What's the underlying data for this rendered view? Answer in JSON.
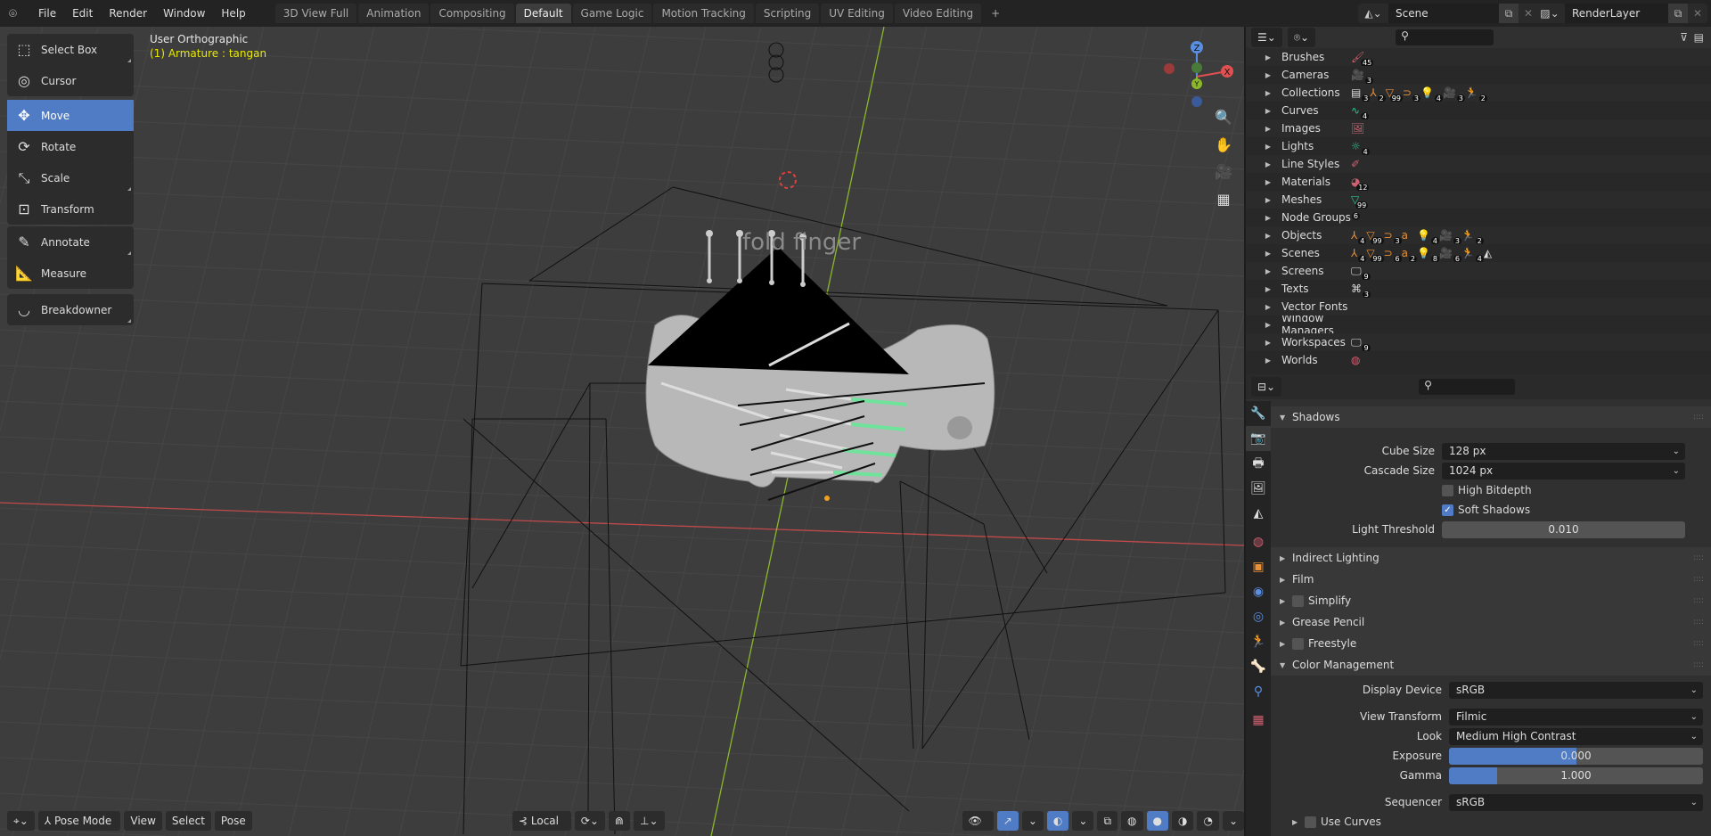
{
  "topbar": {
    "menus": [
      "File",
      "Edit",
      "Render",
      "Window",
      "Help"
    ],
    "workspaces": [
      "3D View Full",
      "Animation",
      "Compositing",
      "Default",
      "Game Logic",
      "Motion Tracking",
      "Scripting",
      "UV Editing",
      "Video Editing"
    ],
    "active_workspace": "Default",
    "add_tab": "+",
    "scene": "Scene",
    "view_layer": "RenderLayer"
  },
  "toolbar": {
    "tools": [
      {
        "label": "Select Box",
        "icon": "select-box-icon",
        "glyph": "⬚"
      },
      {
        "label": "Cursor",
        "icon": "cursor-icon",
        "glyph": "◎"
      },
      {
        "label": "Move",
        "icon": "move-icon",
        "glyph": "✥",
        "active": true
      },
      {
        "label": "Rotate",
        "icon": "rotate-icon",
        "glyph": "⟳"
      },
      {
        "label": "Scale",
        "icon": "scale-icon",
        "glyph": "⤡"
      },
      {
        "label": "Transform",
        "icon": "transform-icon",
        "glyph": "⊡"
      },
      {
        "label": "Annotate",
        "icon": "annotate-icon",
        "glyph": "✎"
      },
      {
        "label": "Measure",
        "icon": "measure-icon",
        "glyph": "📐"
      },
      {
        "label": "Breakdowner",
        "icon": "breakdowner-icon",
        "glyph": "◡"
      }
    ]
  },
  "viewport": {
    "view_name": "User Orthographic",
    "active_object": "(1) Armature : tangan",
    "overlay_text": "fold finger",
    "gizmo": {
      "z": "Z",
      "x": "X",
      "y": "Y"
    },
    "header": {
      "mode": "Pose Mode",
      "menus": [
        "View",
        "Select",
        "Pose"
      ],
      "orientation": "Local"
    }
  },
  "outliner": {
    "rows": [
      {
        "label": "Brushes",
        "icons": [
          {
            "g": "🖌",
            "c": "#d06070",
            "n": "45"
          }
        ]
      },
      {
        "label": "Cameras",
        "icons": [
          {
            "g": "🎥",
            "c": "#30c090",
            "n": "3"
          }
        ]
      },
      {
        "label": "Collections",
        "icons": [
          {
            "g": "▤",
            "c": "#ddd",
            "n": "3"
          },
          {
            "g": "⅄",
            "c": "#e8903a",
            "n": "2"
          },
          {
            "g": "▽",
            "c": "#e8903a",
            "n": "99"
          },
          {
            "g": "⊃",
            "c": "#e8903a",
            "n": "3"
          },
          {
            "g": "💡",
            "c": "#e8903a",
            "n": "4"
          },
          {
            "g": "🎥",
            "c": "#e8903a",
            "n": "3"
          },
          {
            "g": "🏃",
            "c": "#e8903a",
            "n": "2"
          }
        ]
      },
      {
        "label": "Curves",
        "icons": [
          {
            "g": "∿",
            "c": "#30c090",
            "n": "4"
          }
        ]
      },
      {
        "label": "Images",
        "icons": [
          {
            "g": "🖼",
            "c": "#d06070",
            "n": ""
          }
        ]
      },
      {
        "label": "Lights",
        "icons": [
          {
            "g": "☼",
            "c": "#30c090",
            "n": "4"
          }
        ]
      },
      {
        "label": "Line Styles",
        "icons": [
          {
            "g": "✐",
            "c": "#d06070",
            "n": ""
          }
        ]
      },
      {
        "label": "Materials",
        "icons": [
          {
            "g": "◕",
            "c": "#d06070",
            "n": "12"
          }
        ]
      },
      {
        "label": "Meshes",
        "icons": [
          {
            "g": "▽",
            "c": "#30c090",
            "n": "99"
          }
        ]
      },
      {
        "label": "Node Groups",
        "icons": [
          {
            "g": " ",
            "c": "#ddd",
            "n": "6"
          }
        ]
      },
      {
        "label": "Objects",
        "icons": [
          {
            "g": "⅄",
            "c": "#e8903a",
            "n": "4"
          },
          {
            "g": "▽",
            "c": "#e8903a",
            "n": "99"
          },
          {
            "g": "⊃",
            "c": "#e8903a",
            "n": "3"
          },
          {
            "g": "a",
            "c": "#e8903a",
            "n": ""
          },
          {
            "g": "💡",
            "c": "#e8903a",
            "n": "4"
          },
          {
            "g": "🎥",
            "c": "#e8903a",
            "n": "3"
          },
          {
            "g": "🏃",
            "c": "#e8903a",
            "n": "2"
          }
        ]
      },
      {
        "label": "Scenes",
        "icons": [
          {
            "g": "⅄",
            "c": "#e8903a",
            "n": "4"
          },
          {
            "g": "▽",
            "c": "#e8903a",
            "n": "99"
          },
          {
            "g": "⊃",
            "c": "#e8903a",
            "n": "6"
          },
          {
            "g": "a",
            "c": "#e8903a",
            "n": "2"
          },
          {
            "g": "💡",
            "c": "#e8903a",
            "n": "8"
          },
          {
            "g": "🎥",
            "c": "#e8903a",
            "n": "6"
          },
          {
            "g": "🏃",
            "c": "#e8903a",
            "n": "4"
          },
          {
            "g": "◭",
            "c": "#ddd",
            "n": ""
          }
        ]
      },
      {
        "label": "Screens",
        "icons": [
          {
            "g": "🖵",
            "c": "#ddd",
            "n": "9"
          }
        ]
      },
      {
        "label": "Texts",
        "icons": [
          {
            "g": "⌘",
            "c": "#ddd",
            "n": "3"
          }
        ]
      },
      {
        "label": "Vector Fonts",
        "icons": []
      },
      {
        "label": "Window Managers",
        "icons": []
      },
      {
        "label": "Workspaces",
        "icons": [
          {
            "g": "🖵",
            "c": "#ddd",
            "n": "9"
          }
        ]
      },
      {
        "label": "Worlds",
        "icons": [
          {
            "g": "◍",
            "c": "#d06070",
            "n": ""
          }
        ]
      }
    ]
  },
  "properties": {
    "tabs": [
      {
        "g": "🔧",
        "c": "#ddd"
      },
      {
        "g": "📷",
        "c": "#ddd",
        "active": true
      },
      {
        "g": "🖶",
        "c": "#ddd"
      },
      {
        "g": "🖼",
        "c": "#ddd"
      },
      {
        "g": "◭",
        "c": "#ddd"
      },
      {
        "g": "◍",
        "c": "#d06070"
      },
      {
        "g": "▣",
        "c": "#e8903a"
      },
      {
        "g": "◉",
        "c": "#5a8ee0"
      },
      {
        "g": "◎",
        "c": "#5a8ee0"
      },
      {
        "g": "🏃",
        "c": "#30c090"
      },
      {
        "g": "🦴",
        "c": "#30c090"
      },
      {
        "g": "⚲",
        "c": "#5a8ee0"
      },
      {
        "g": "▦",
        "c": "#d06070"
      }
    ],
    "shadows": {
      "title": "Shadows",
      "cube_size_label": "Cube Size",
      "cube_size": "128 px",
      "cascade_size_label": "Cascade Size",
      "cascade_size": "1024 px",
      "high_bitdepth_label": "High Bitdepth",
      "high_bitdepth": false,
      "soft_shadows_label": "Soft Shadows",
      "soft_shadows": true,
      "light_threshold_label": "Light Threshold",
      "light_threshold": "0.010"
    },
    "collapsed_panels": [
      {
        "title": "Indirect Lighting"
      },
      {
        "title": "Film"
      },
      {
        "title": "Simplify",
        "checkbox": true
      },
      {
        "title": "Grease Pencil"
      },
      {
        "title": "Freestyle",
        "checkbox": true
      }
    ],
    "color_management": {
      "title": "Color Management",
      "display_device_label": "Display Device",
      "display_device": "sRGB",
      "view_transform_label": "View Transform",
      "view_transform": "Filmic",
      "look_label": "Look",
      "look": "Medium High Contrast",
      "exposure_label": "Exposure",
      "exposure": "0.000",
      "exposure_fill": 0.5,
      "gamma_label": "Gamma",
      "gamma": "1.000",
      "gamma_fill": 0.19,
      "sequencer_label": "Sequencer",
      "sequencer": "sRGB",
      "use_curves_label": "Use Curves"
    }
  },
  "colors": {
    "accent": "#4f7cc5",
    "x_axis": "#c04a4a",
    "y_axis": "#8ab82a",
    "active_text": "#e8e800"
  }
}
